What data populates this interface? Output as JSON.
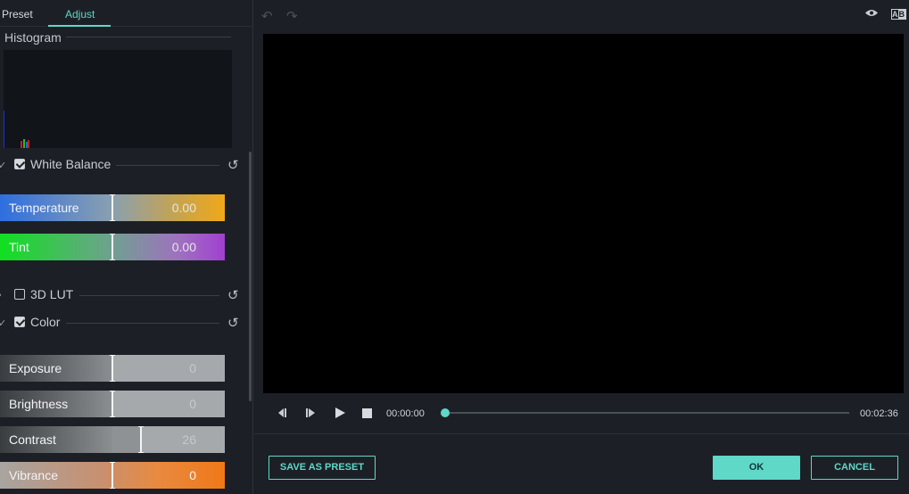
{
  "tabs": {
    "preset": "Preset",
    "adjust": "Adjust"
  },
  "histogram": {
    "title": "Histogram"
  },
  "white_balance": {
    "label": "White Balance",
    "checked": true,
    "temperature": {
      "label": "Temperature",
      "value": "0.00",
      "level": 0.5
    },
    "tint": {
      "label": "Tint",
      "value": "0.00",
      "level": 0.5
    }
  },
  "lut": {
    "label": "3D LUT",
    "checked": false
  },
  "color": {
    "label": "Color",
    "checked": true,
    "exposure": {
      "label": "Exposure",
      "value": "0",
      "level": 0.5
    },
    "brightness": {
      "label": "Brightness",
      "value": "0",
      "level": 0.5
    },
    "contrast": {
      "label": "Contrast",
      "value": "26",
      "level": 0.63
    },
    "vibrance": {
      "label": "Vibrance",
      "value": "0",
      "level": 0.5
    }
  },
  "player": {
    "current_time": "00:00:00",
    "total_time": "00:02:36",
    "progress": 0
  },
  "buttons": {
    "save_preset": "SAVE AS PRESET",
    "ok": "OK",
    "cancel": "CANCEL"
  },
  "compare_label_a": "A",
  "compare_label_b": "B",
  "icons": [
    "undo-icon",
    "redo-icon",
    "eye-icon",
    "compare-ab-icon",
    "reset-icon",
    "prev-frame-icon",
    "play-frame-icon",
    "play-icon",
    "stop-icon"
  ],
  "colors": {
    "accent": "#5fd8c8",
    "background": "#1c2026",
    "viewer": "#000000"
  }
}
